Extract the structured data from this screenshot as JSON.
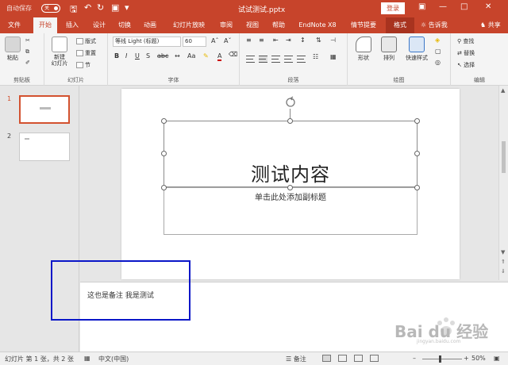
{
  "titlebar": {
    "autosave": "自动保存",
    "autosave_state": "关",
    "doc_title": "试试测试.pptx",
    "login": "登录",
    "accent": "#c7442b"
  },
  "tabs": {
    "file": "文件",
    "home": "开始",
    "insert": "插入",
    "design": "设计",
    "transitions": "切换",
    "animations": "动画",
    "slideshow": "幻灯片放映",
    "review": "审阅",
    "view": "视图",
    "help": "帮助",
    "endnote": "EndNote X8",
    "storyboard": "情节提要",
    "format": "格式",
    "tellme": "告诉我",
    "share": "共享"
  },
  "ribbon": {
    "clipboard": {
      "paste": "粘贴",
      "label": "剪贴板"
    },
    "slides": {
      "new_slide": "新建\n幻灯片",
      "layout": "版式",
      "reset": "重置",
      "section": "节",
      "label": "幻灯片"
    },
    "font": {
      "font_name": "等线 Light (标题)",
      "font_size": "60",
      "label": "字体"
    },
    "paragraph": {
      "label": "段落"
    },
    "drawing": {
      "shapes": "形状",
      "arrange": "排列",
      "quick_styles": "快速样式",
      "label": "绘图"
    },
    "editing": {
      "find": "查找",
      "replace": "替换",
      "select": "选择",
      "label": "编辑"
    }
  },
  "thumbnails": [
    {
      "number": "1",
      "selected": true
    },
    {
      "number": "2",
      "selected": false
    }
  ],
  "slide": {
    "title": "测试内容",
    "subtitle": "单击此处添加副标题"
  },
  "notes": {
    "text": "这也是备注 我是测试"
  },
  "statusbar": {
    "slide_info": "幻灯片 第 1 张，共 2 张",
    "language": "中文(中国)",
    "notes": "备注",
    "zoom": "50%"
  },
  "watermark": {
    "brand": "Bai du 经验",
    "url": "jingyan.baidu.com"
  }
}
